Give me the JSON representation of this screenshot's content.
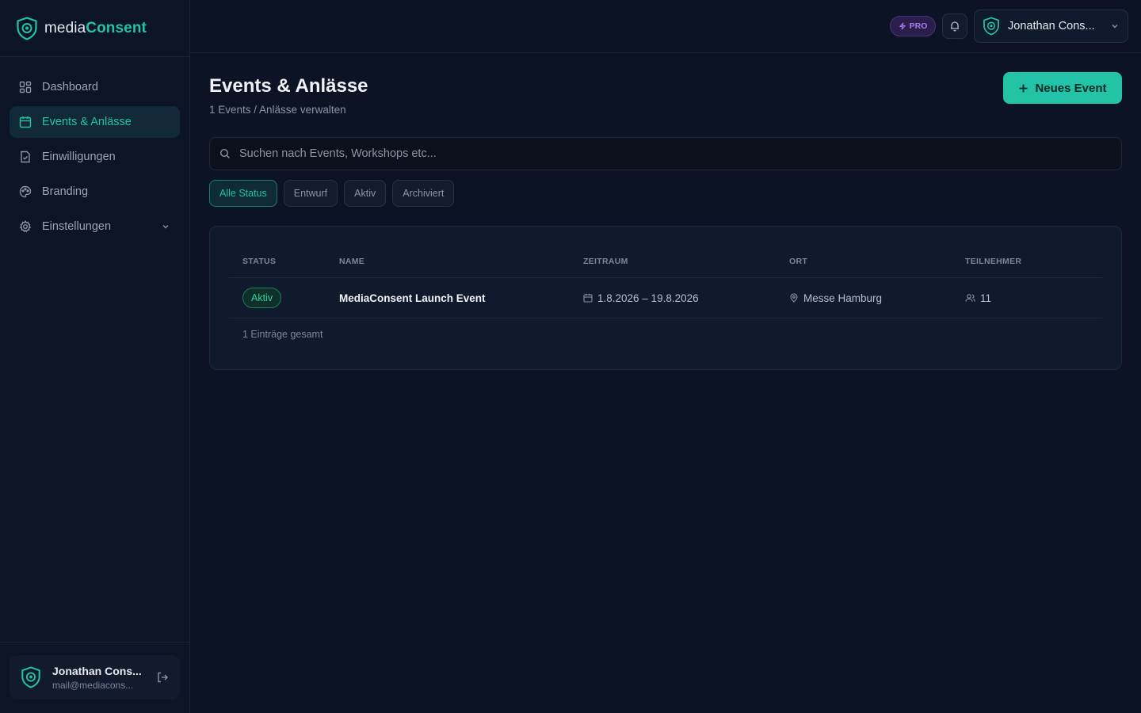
{
  "brand": {
    "name_part1": "media",
    "name_part2": "Consent",
    "accent": "#22c3a6"
  },
  "sidebar": {
    "items": [
      {
        "label": "Dashboard",
        "icon": "dashboard-icon",
        "active": false
      },
      {
        "label": "Events & Anlässe",
        "icon": "calendar-icon",
        "active": true
      },
      {
        "label": "Einwilligungen",
        "icon": "document-check-icon",
        "active": false
      },
      {
        "label": "Branding",
        "icon": "palette-icon",
        "active": false
      },
      {
        "label": "Einstellungen",
        "icon": "gear-icon",
        "active": false
      }
    ],
    "user": {
      "name": "Jonathan Cons...",
      "email": "mail@mediacons..."
    }
  },
  "topbar": {
    "pro_label": "PRO",
    "pro_color": "#a57cf0",
    "account_name": "Jonathan Cons..."
  },
  "page": {
    "title": "Events & Anlässe",
    "subtitle": "1 Events / Anlässe verwalten",
    "new_button": "Neues Event"
  },
  "search": {
    "placeholder": "Suchen nach Events, Workshops etc..."
  },
  "filters": [
    {
      "label": "Alle Status",
      "active": true
    },
    {
      "label": "Entwurf",
      "active": false
    },
    {
      "label": "Aktiv",
      "active": false
    },
    {
      "label": "Archiviert",
      "active": false
    }
  ],
  "table": {
    "columns": [
      "STATUS",
      "NAME",
      "ZEITRAUM",
      "ORT",
      "TEILNEHMER"
    ],
    "rows": [
      {
        "status": "Aktiv",
        "name": "MediaConsent Launch Event",
        "period": "1.8.2026 – 19.8.2026",
        "location": "Messe Hamburg",
        "participants": "11"
      }
    ],
    "total": "1 Einträge gesamt"
  }
}
